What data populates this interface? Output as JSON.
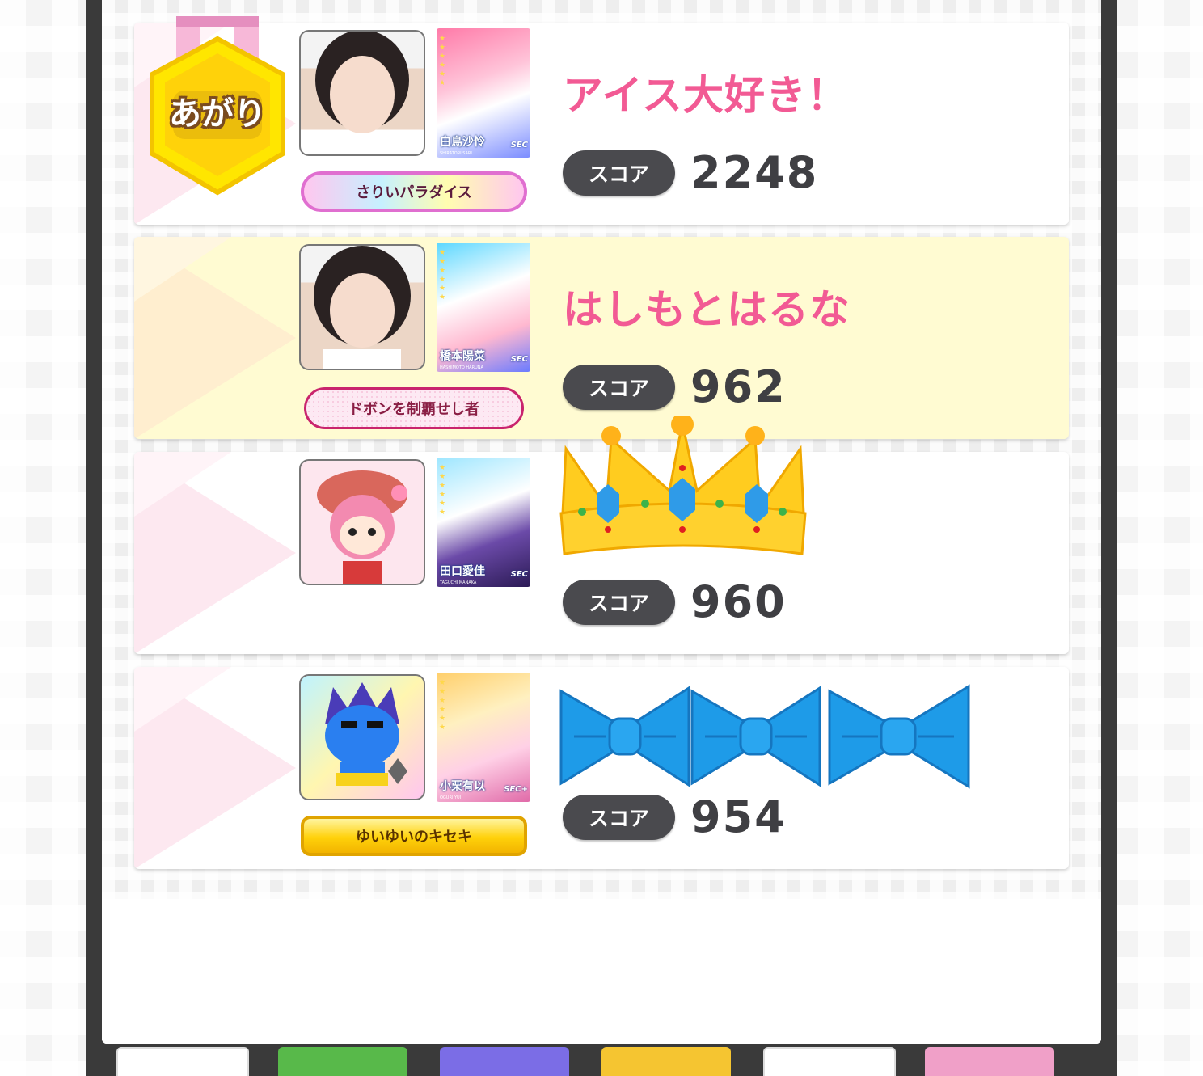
{
  "rows": [
    {
      "player_name": "アイス大好き！",
      "score_label": "スコア",
      "score": "2248",
      "title_badge": "さりいパラダイス",
      "card_name": "白鳥沙怜",
      "card_romaji": "SHIRATORI SARI",
      "card_badge": "SEC",
      "medal_text": "あがり",
      "avatar": "member-photo-avatar",
      "sticker": "agari-medal-icon"
    },
    {
      "player_name": "はしもとはるな",
      "score_label": "スコア",
      "score": "962",
      "title_badge": "ドボンを制覇せし者",
      "card_name": "橋本陽菜",
      "card_romaji": "HASHIMOTO HARUNA",
      "card_badge": "SEC",
      "avatar": "member-photo-avatar"
    },
    {
      "player_name": "",
      "score_label": "スコア",
      "score": "960",
      "title_badge": "",
      "card_name": "田口愛佳",
      "card_romaji": "TAGUCHI MANAKA",
      "card_badge": "SEC",
      "avatar": "cartoon-hat-character-avatar",
      "sticker": "crown-icon"
    },
    {
      "player_name": "",
      "score_label": "スコア",
      "score": "954",
      "title_badge": "ゆいゆいのキセキ",
      "card_name": "小栗有以",
      "card_romaji": "OGURI YUI",
      "card_badge": "SEC+",
      "avatar": "blue-oni-character-avatar",
      "sticker": "blue-ribbon-icon"
    }
  ],
  "colors": {
    "player_name": "#f25a94",
    "score_pill": "#4a4a4e",
    "highlight_row": "#fffbd2",
    "crown_gold": "#ffcc1f",
    "ribbon_blue": "#1e9be8"
  }
}
